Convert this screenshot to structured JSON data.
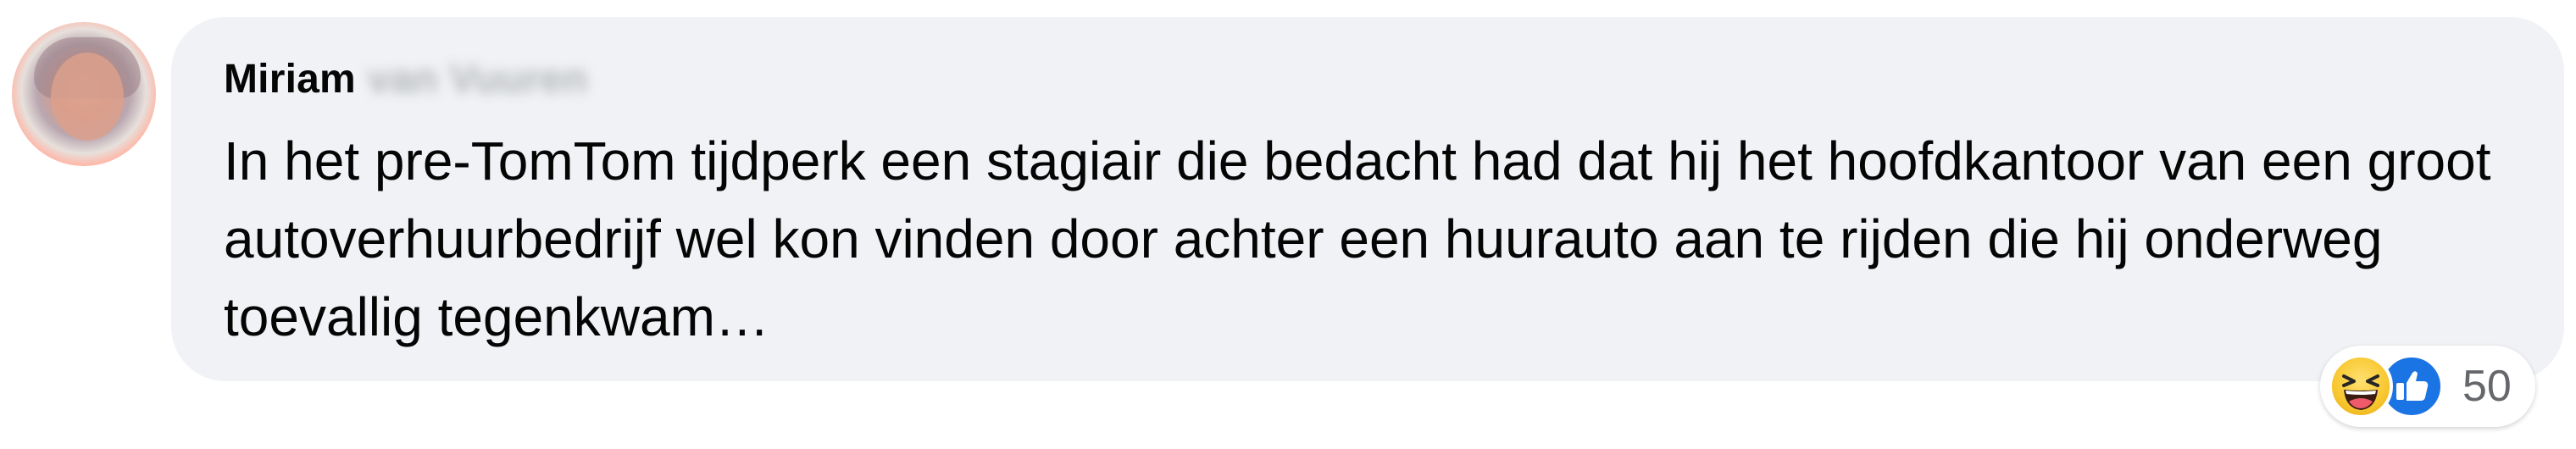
{
  "comment": {
    "author": {
      "first_name": "Miriam",
      "last_name": "van Vuuren"
    },
    "text": "In het pre-TomTom tijdperk een stagiair die bedacht had dat hij het hoofdkantoor van een groot autoverhuurbedrijf wel kon vinden door achter een huurauto aan te rijden die hij onderweg toevallig tegenkwam…"
  },
  "reactions": {
    "icons": [
      "haha-emoji-icon",
      "like-thumb-icon"
    ],
    "count": "50"
  },
  "colors": {
    "bubble_bg": "#f0f2f5",
    "text": "#050505",
    "secondary": "#65676b",
    "like_blue": "#1b74e4",
    "haha_yellow": "#f7c72f"
  }
}
